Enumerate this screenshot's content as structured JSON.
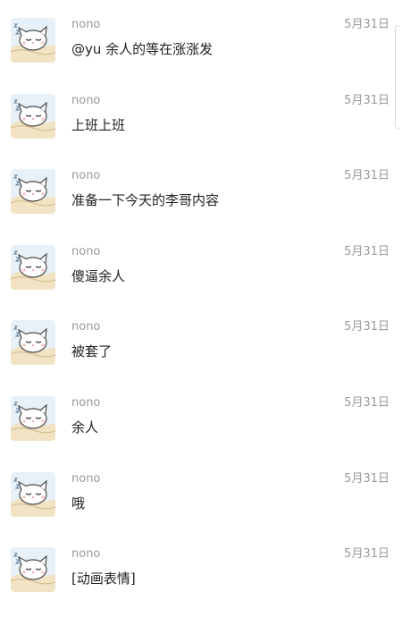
{
  "colors": {
    "background": "#ffffff",
    "name": "#9a9a9a",
    "time": "#9a9a9a",
    "content": "#222222"
  },
  "comments": [
    {
      "name": "nono",
      "time": "5月31日",
      "content": "@yu 余人的等在涨涨发",
      "avatar_icon": "sleeping-cat-avatar-icon"
    },
    {
      "name": "nono",
      "time": "5月31日",
      "content": "上班上班",
      "avatar_icon": "sleeping-cat-avatar-icon"
    },
    {
      "name": "nono",
      "time": "5月31日",
      "content": "准备一下今天的李哥内容",
      "avatar_icon": "sleeping-cat-avatar-icon"
    },
    {
      "name": "nono",
      "time": "5月31日",
      "content": "傻逼余人",
      "avatar_icon": "sleeping-cat-avatar-icon"
    },
    {
      "name": "nono",
      "time": "5月31日",
      "content": "被套了",
      "avatar_icon": "sleeping-cat-avatar-icon"
    },
    {
      "name": "nono",
      "time": "5月31日",
      "content": "余人",
      "avatar_icon": "sleeping-cat-avatar-icon"
    },
    {
      "name": "nono",
      "time": "5月31日",
      "content": "哦",
      "avatar_icon": "sleeping-cat-avatar-icon"
    },
    {
      "name": "nono",
      "time": "5月31日",
      "content": "[动画表情]",
      "avatar_icon": "sleeping-cat-avatar-icon"
    }
  ]
}
